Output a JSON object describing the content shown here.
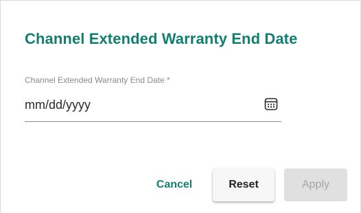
{
  "dialog": {
    "title": "Channel Extended Warranty End Date"
  },
  "field": {
    "label": "Channel Extended Warranty End Date *",
    "value": "",
    "placeholder": "mm/dd/yyyy",
    "icon": "calendar-icon"
  },
  "actions": {
    "cancel_label": "Cancel",
    "reset_label": "Reset",
    "apply_label": "Apply",
    "apply_disabled": true
  },
  "colors": {
    "accent": "#127e72",
    "disabled_bg": "#e0e0e0",
    "disabled_text": "#a6a6a6"
  }
}
